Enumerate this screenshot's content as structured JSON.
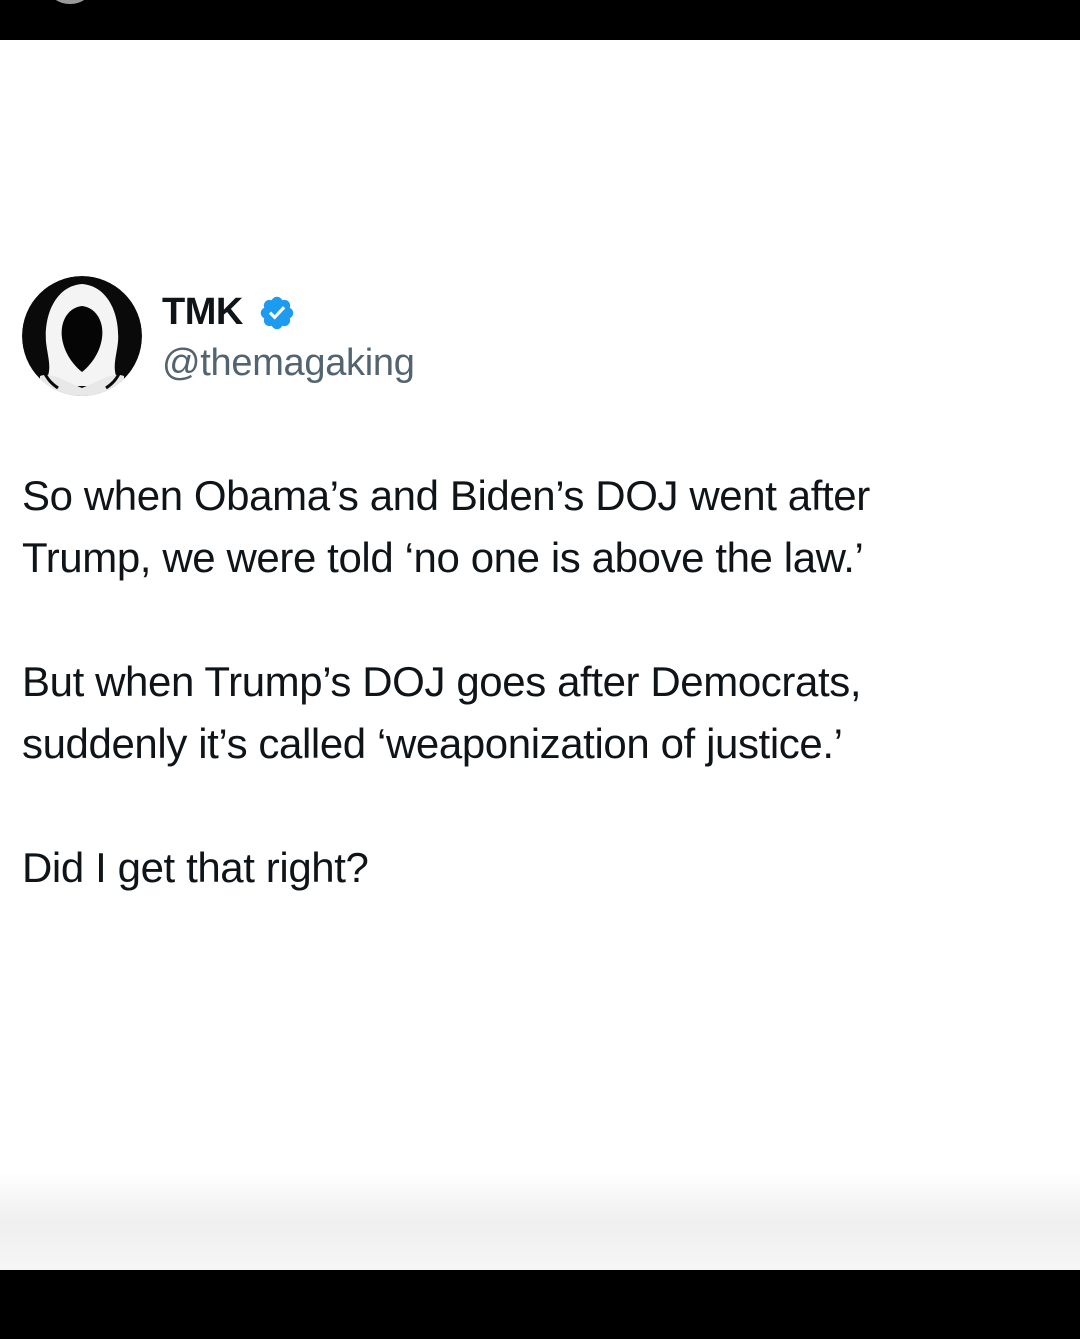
{
  "author": {
    "display_name": "TMK",
    "handle": "@themagaking",
    "verified": true,
    "avatar_icon": "hooded-figure-avatar",
    "verified_badge_color": "#1d9bf0"
  },
  "tweet": {
    "paragraphs": [
      "So when Obama’s and Biden’s DOJ went after\nTrump, we were told ‘no one is above the law.’",
      "But when Trump’s DOJ goes after Democrats,\nsuddenly it’s called ‘weaponization of justice.’",
      "Did I get that right?"
    ]
  },
  "colors": {
    "text": "#0f1419",
    "secondary_text": "#536471",
    "background": "#ffffff",
    "frame": "#000000"
  }
}
